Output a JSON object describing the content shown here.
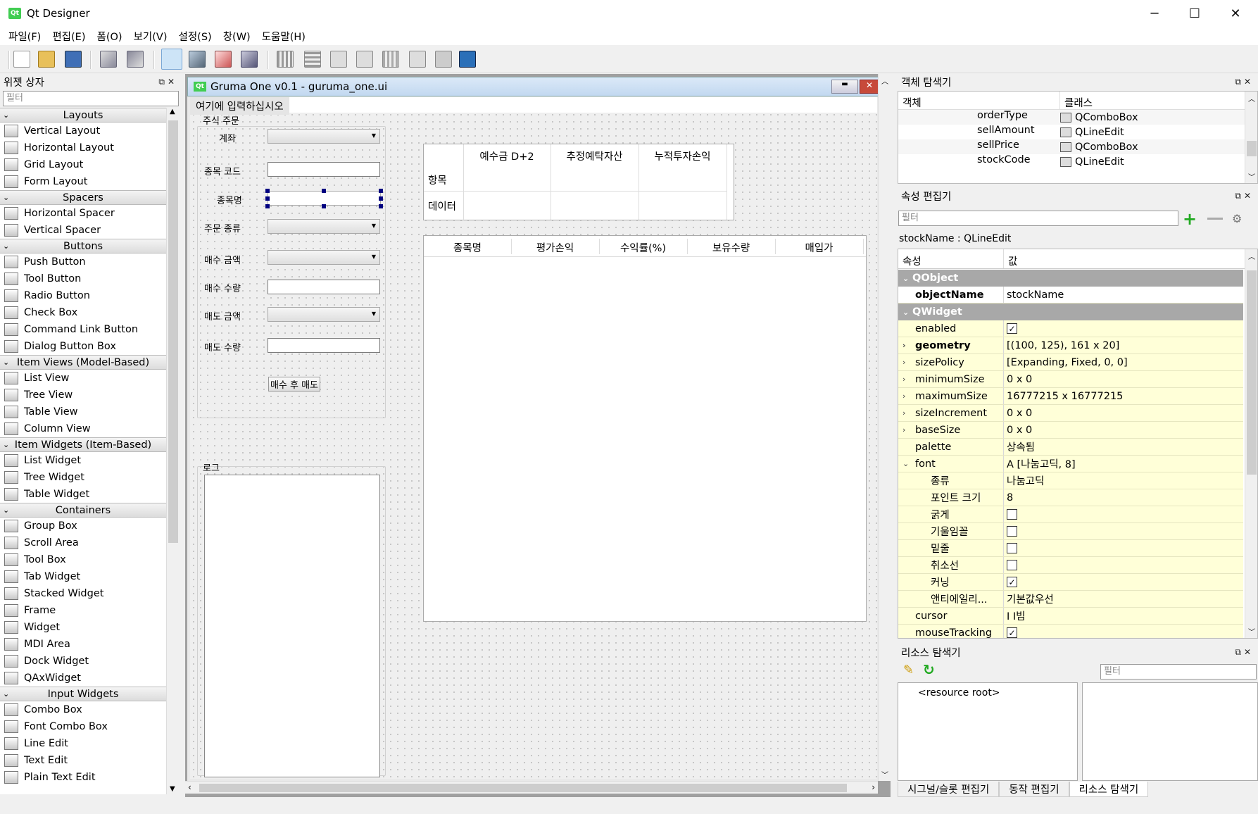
{
  "window": {
    "title": "Qt Designer",
    "app_icon": "Qt",
    "controls": [
      "─",
      "☐",
      "✕"
    ]
  },
  "menu": [
    "파일(F)",
    "편집(E)",
    "폼(O)",
    "보기(V)",
    "설정(S)",
    "창(W)",
    "도움말(H)"
  ],
  "widget_box": {
    "title": "위젯 상자",
    "filter_placeholder": "필터",
    "categories": [
      {
        "name": "Layouts",
        "items": [
          "Vertical Layout",
          "Horizontal Layout",
          "Grid Layout",
          "Form Layout"
        ]
      },
      {
        "name": "Spacers",
        "items": [
          "Horizontal Spacer",
          "Vertical Spacer"
        ]
      },
      {
        "name": "Buttons",
        "items": [
          "Push Button",
          "Tool Button",
          "Radio Button",
          "Check Box",
          "Command Link Button",
          "Dialog Button Box"
        ]
      },
      {
        "name": "Item Views (Model-Based)",
        "items": [
          "List View",
          "Tree View",
          "Table View",
          "Column View"
        ]
      },
      {
        "name": "Item Widgets (Item-Based)",
        "items": [
          "List Widget",
          "Tree Widget",
          "Table Widget"
        ]
      },
      {
        "name": "Containers",
        "items": [
          "Group Box",
          "Scroll Area",
          "Tool Box",
          "Tab Widget",
          "Stacked Widget",
          "Frame",
          "Widget",
          "MDI Area",
          "Dock Widget",
          "QAxWidget"
        ]
      },
      {
        "name": "Input Widgets",
        "items": [
          "Combo Box",
          "Font Combo Box",
          "Line Edit",
          "Text Edit",
          "Plain Text Edit"
        ]
      }
    ]
  },
  "form": {
    "title": "Gruma One v0.1 - guruma_one.ui",
    "qt_badge": "Qt",
    "menu_placeholder": "여기에 입력하십시오",
    "order_group": {
      "title": "주식 주문",
      "labels": [
        "계좌",
        "종목 코드",
        "종목명",
        "주문 종류",
        "매수 금액",
        "매수 수량",
        "매도 금액",
        "매도 수량"
      ]
    },
    "button": "매수 후 매도",
    "log_group": {
      "title": "로그"
    },
    "summary_table": {
      "columns": [
        "예수금 D+2",
        "추정예탁자산",
        "누적투자손익"
      ],
      "rows": [
        "항목",
        "데이터"
      ]
    },
    "holdings_table": {
      "columns": [
        "종목명",
        "평가손익",
        "수익률(%)",
        "보유수량",
        "매입가"
      ]
    }
  },
  "object_inspector": {
    "title": "객체 탐색기",
    "col_object": "객체",
    "col_class": "클래스",
    "rows": [
      {
        "name": "orderType",
        "class": "QComboBox"
      },
      {
        "name": "sellAmount",
        "class": "QLineEdit"
      },
      {
        "name": "sellPrice",
        "class": "QComboBox"
      },
      {
        "name": "stockCode",
        "class": "QLineEdit"
      }
    ]
  },
  "property_editor": {
    "title": "속성 편집기",
    "filter_placeholder": "필터",
    "context": "stockName : QLineEdit",
    "col_prop": "속성",
    "col_value": "값",
    "rows": [
      {
        "type": "group",
        "name": "QObject"
      },
      {
        "name": "objectName",
        "value": "stockName",
        "bold": true,
        "white": true
      },
      {
        "type": "group",
        "name": "QWidget"
      },
      {
        "name": "enabled",
        "check": true
      },
      {
        "name": "geometry",
        "value": "[(100, 125), 161 x 20]",
        "bold": true,
        "exp": "›"
      },
      {
        "name": "sizePolicy",
        "value": "[Expanding, Fixed, 0, 0]",
        "exp": "›"
      },
      {
        "name": "minimumSize",
        "value": "0 x 0",
        "exp": "›"
      },
      {
        "name": "maximumSize",
        "value": "16777215 x 16777215",
        "exp": "›"
      },
      {
        "name": "sizeIncrement",
        "value": "0 x 0",
        "exp": "›"
      },
      {
        "name": "baseSize",
        "value": "0 x 0",
        "exp": "›"
      },
      {
        "name": "palette",
        "value": "상속됨"
      },
      {
        "name": "font",
        "value": "A  [나눔고딕, 8]",
        "exp": "⌄"
      },
      {
        "name": "종류",
        "value": "나눔고딕",
        "sub": true
      },
      {
        "name": "포인트 크기",
        "value": "8",
        "sub": true
      },
      {
        "name": "굵게",
        "check": false,
        "sub": true
      },
      {
        "name": "기울임꼴",
        "check": false,
        "sub": true
      },
      {
        "name": "밑줄",
        "check": false,
        "sub": true
      },
      {
        "name": "취소선",
        "check": false,
        "sub": true
      },
      {
        "name": "커닝",
        "check": true,
        "sub": true
      },
      {
        "name": "앤티에일리...",
        "value": "기본값우선",
        "sub": true
      },
      {
        "name": "cursor",
        "value": "I  I빔"
      },
      {
        "name": "mouseTracking",
        "check": true
      }
    ]
  },
  "resource_browser": {
    "title": "리소스 탐색기",
    "filter_placeholder": "필터",
    "root": "<resource root>"
  },
  "bottom_tabs": [
    "시그널/슬롯 편집기",
    "동작 편집기",
    "리소스 탐색기"
  ]
}
